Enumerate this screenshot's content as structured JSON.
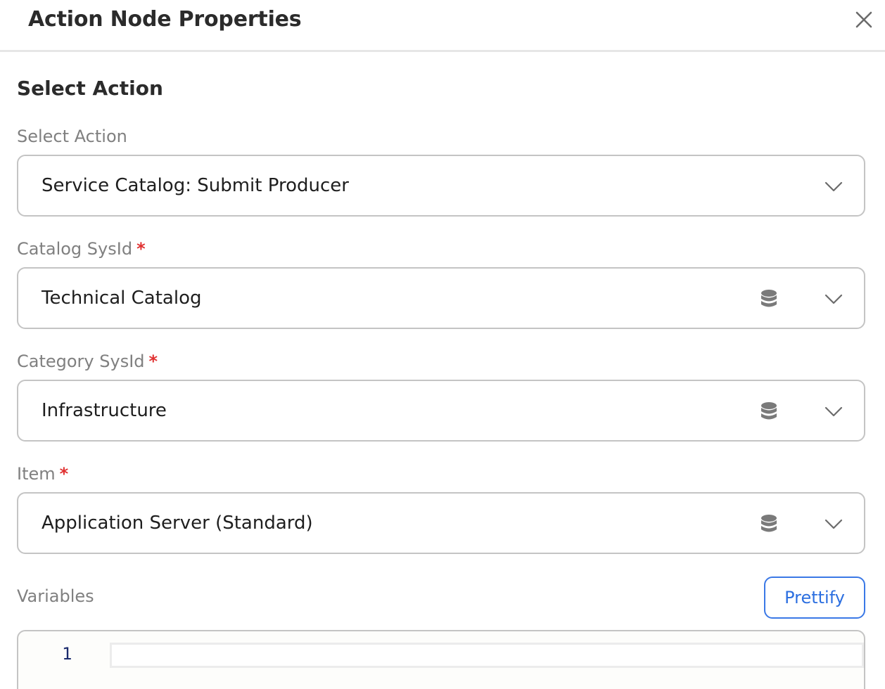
{
  "header": {
    "title": "Action Node Properties",
    "close_icon": "close-icon"
  },
  "section": {
    "title": "Select Action"
  },
  "fields": {
    "action": {
      "label": "Select Action",
      "required": false,
      "value": "Service Catalog: Submit Producer",
      "icons": [
        "chevron-down-icon"
      ]
    },
    "catalog": {
      "label": "Catalog SysId",
      "required_marker": "*",
      "value": "Technical Catalog",
      "icons": [
        "database-icon",
        "chevron-down-icon"
      ]
    },
    "category": {
      "label": "Category SysId",
      "required_marker": "*",
      "value": "Infrastructure",
      "icons": [
        "database-icon",
        "chevron-down-icon"
      ]
    },
    "item": {
      "label": "Item",
      "required_marker": "*",
      "value": "Application Server (Standard)",
      "icons": [
        "database-icon",
        "chevron-down-icon"
      ]
    }
  },
  "variables": {
    "label": "Variables",
    "prettify_label": "Prettify",
    "editor": {
      "line_numbers": [
        "1"
      ],
      "content": ""
    }
  },
  "colors": {
    "accent": "#2c6fe0",
    "required": "#e03131",
    "label": "#808080",
    "border": "#c4c4c4"
  }
}
